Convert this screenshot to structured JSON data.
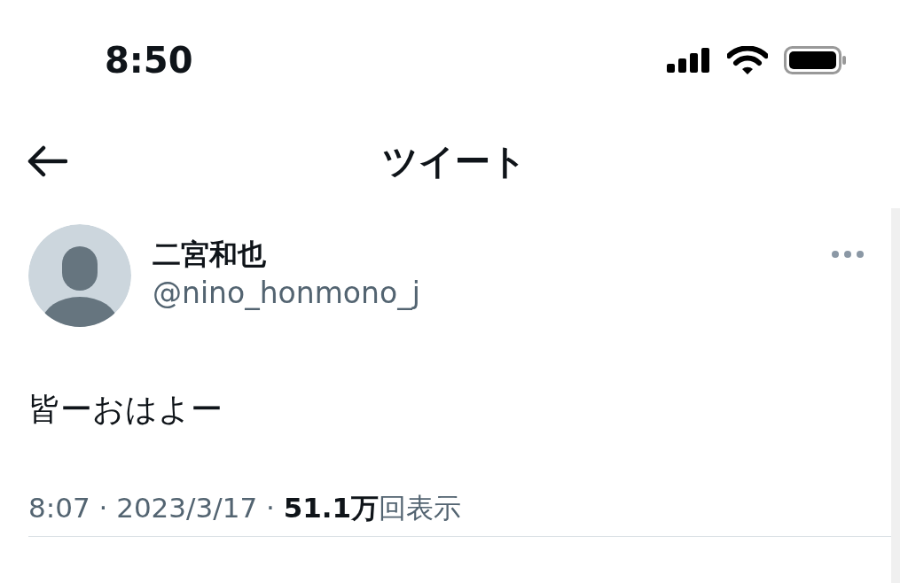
{
  "status_bar": {
    "time": "8:50"
  },
  "header": {
    "title": "ツイート"
  },
  "tweet": {
    "author_name": "二宮和也",
    "handle": "@nino_honmono_j",
    "text": "皆ーおはよー",
    "meta": "8:07 · 2023/3/17 · **51.1万**回表示"
  }
}
